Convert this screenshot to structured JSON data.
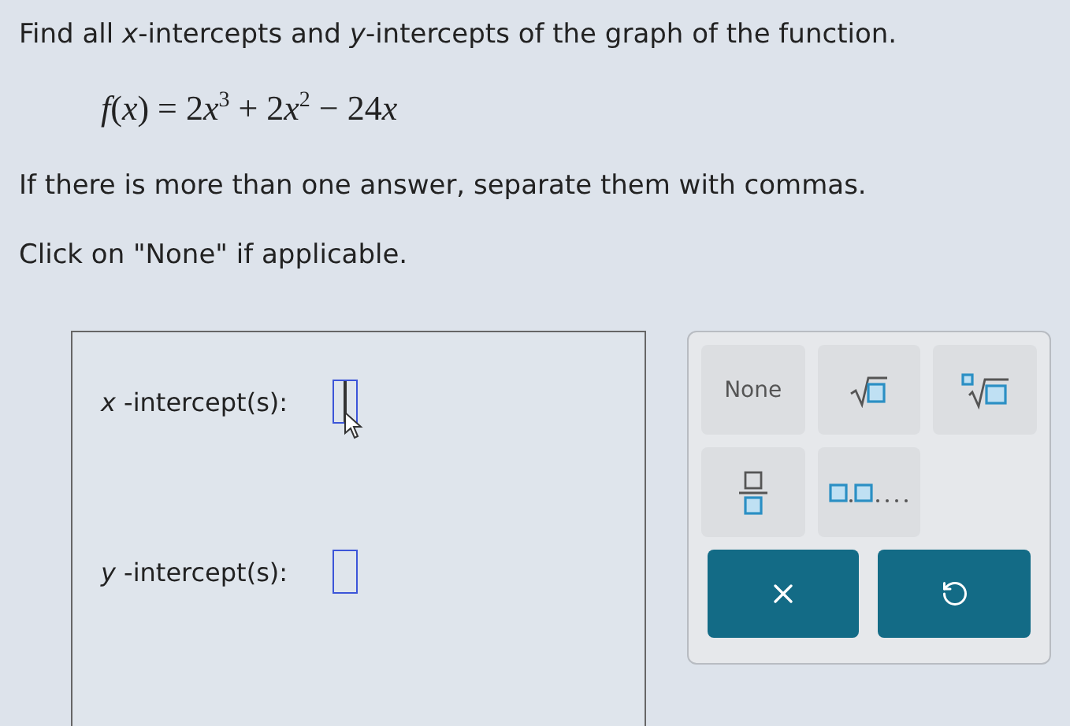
{
  "question": {
    "prompt": "Find all *x*-intercepts and *y*-intercepts of the graph of the function.",
    "formula": [
      "*f*(*x*) = 2",
      "*x*$^{3}$ + 2",
      "*x*$^{2}$ − 24",
      "*x*"
    ],
    "notes": [
      "If there is more than one answer, separate them with commas.",
      "Click on \"None\" if applicable."
    ]
  },
  "answers": [
    {
      "label": "*x* -intercept(s):",
      "focused": true
    },
    {
      "label": "*y* -intercept(s):",
      "focused": false
    }
  ],
  "keypad": {
    "keys": [
      {
        "kind": "text",
        "label": "None"
      },
      {
        "kind": "sqrt"
      },
      {
        "kind": "nroot"
      },
      {
        "kind": "fraction"
      },
      {
        "kind": "list"
      }
    ],
    "actions": [
      {
        "kind": "clear"
      },
      {
        "kind": "undo"
      }
    ]
  }
}
